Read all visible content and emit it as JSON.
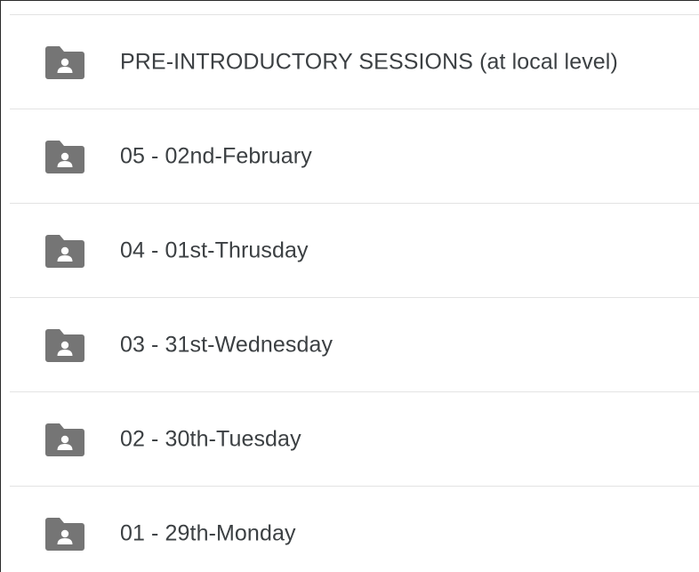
{
  "folders": [
    {
      "label": "PRE-INTRODUCTORY SESSIONS (at local level)",
      "icon": "shared-folder-icon"
    },
    {
      "label": "05 - 02nd-February",
      "icon": "shared-folder-icon"
    },
    {
      "label": "04 - 01st-Thrusday",
      "icon": "shared-folder-icon"
    },
    {
      "label": "03 - 31st-Wednesday",
      "icon": "shared-folder-icon"
    },
    {
      "label": "02 - 30th-Tuesday",
      "icon": "shared-folder-icon"
    },
    {
      "label": "01 - 29th-Monday",
      "icon": "shared-folder-icon"
    }
  ],
  "colors": {
    "icon": "#757575",
    "text": "#3c4043",
    "divider": "#e3e3e3"
  }
}
